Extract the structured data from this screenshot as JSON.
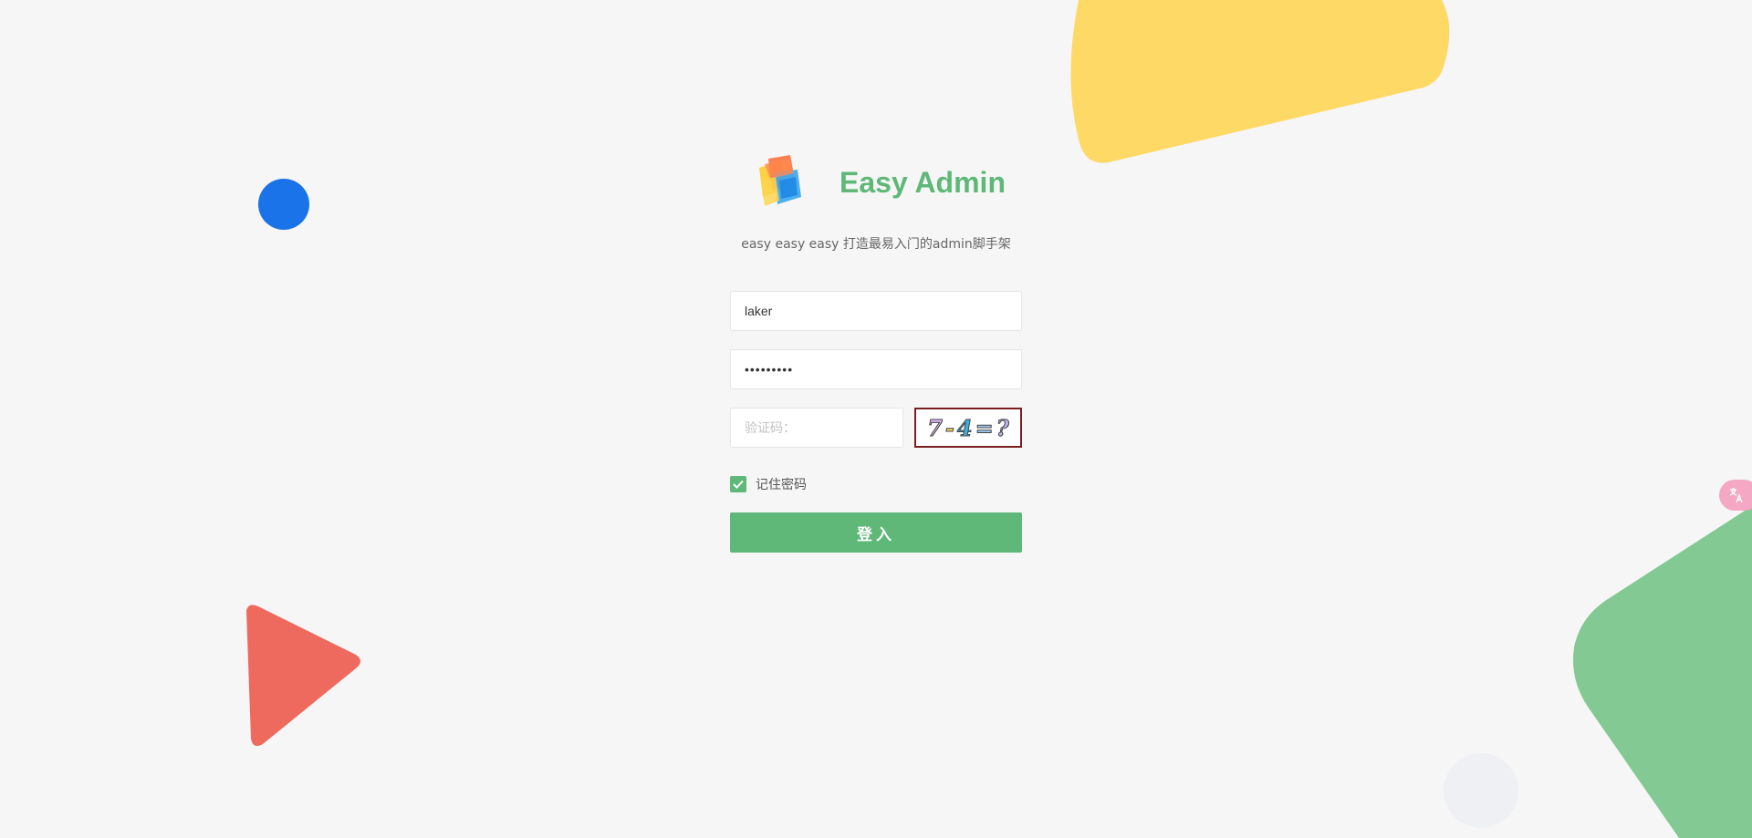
{
  "brand": {
    "title": "Easy Admin",
    "logo_icon": "cube-logo-icon",
    "subtitle": "easy easy easy 打造最易入门的admin脚手架"
  },
  "form": {
    "username_value": "laker",
    "password_value": "laker1234",
    "captcha_placeholder": "验证码：",
    "captcha_image_text": [
      "7",
      "-",
      "4",
      "=",
      "?"
    ],
    "remember_label": "记住密码",
    "remember_checked": true,
    "submit_label": "登入"
  },
  "translate_icon": "translate-icon",
  "colors": {
    "accent": "#5fb878",
    "background": "#f6f6f6",
    "yellow_shape": "#ffd966",
    "blue_circle": "#1a73e8",
    "red_triangle": "#ef6a5e",
    "green_shape": "#82c993"
  }
}
